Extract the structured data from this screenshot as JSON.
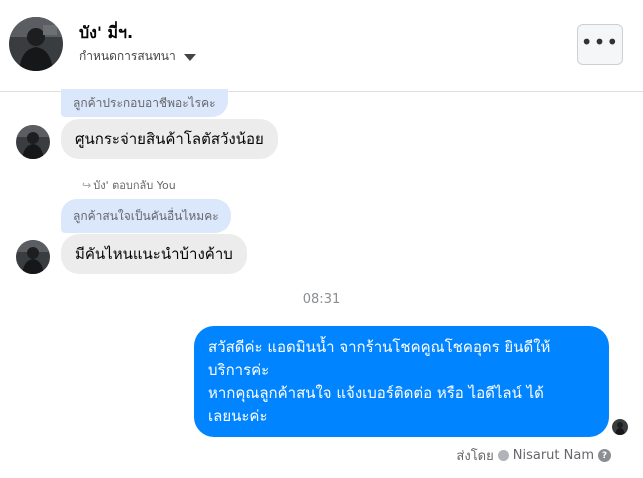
{
  "header": {
    "title": "บัง' มี่ฯ.",
    "subtitle": "กำหนดการสนทนา",
    "more_label": "•••"
  },
  "messages": {
    "quote1": "ลูกค้าประกอบอาชีพอะไรคะ",
    "reply1": "ศูนกระจ่ายสินค้าโลตัสวังน้อย",
    "replied_note": "บัง' ตอบกลับ You",
    "quote2": "ลูกค้าสนใจเป็นคันอื่นไหมคะ",
    "reply2": "มีคันไหนแนะนำบ้างค้าบ",
    "time": "08:31",
    "outgoing": {
      "line1": "สวัสดีค่ะ แอดมินน้ำ จากร้านโชคคูณโชคอุดร ยินดีให้",
      "line2": "บริการค่ะ",
      "line3": "หากคุณลูกค้าสนใจ แจ้งเบอร์ติดต่อ หรือ ไอดีไลน์ ได้",
      "line4": "เลยนะค่ะ"
    }
  },
  "footer": {
    "sent_by_label": "ส่งโดย",
    "sender_name": "Nisarut Nam",
    "help_glyph": "?"
  },
  "colors": {
    "outgoing_bubble": "#0084ff",
    "incoming_bubble": "#ececec",
    "quote_bubble": "#dbe7fb"
  }
}
